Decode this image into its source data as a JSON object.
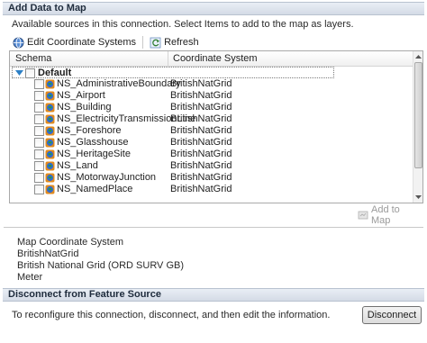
{
  "add_section": {
    "title": "Add Data to Map",
    "description": "Available sources in this connection.  Select Items to add to the map as layers."
  },
  "toolbar": {
    "edit_label": "Edit Coordinate Systems",
    "refresh_label": "Refresh"
  },
  "grid": {
    "columns": [
      "Schema",
      "Coordinate System"
    ],
    "group": "Default",
    "rows": [
      {
        "name": "NS_AdministrativeBoundary",
        "cs": "BritishNatGrid"
      },
      {
        "name": "NS_Airport",
        "cs": "BritishNatGrid"
      },
      {
        "name": "NS_Building",
        "cs": "BritishNatGrid"
      },
      {
        "name": "NS_ElectricityTransmissionLine",
        "cs": "BritishNatGrid"
      },
      {
        "name": "NS_Foreshore",
        "cs": "BritishNatGrid"
      },
      {
        "name": "NS_Glasshouse",
        "cs": "BritishNatGrid"
      },
      {
        "name": "NS_HeritageSite",
        "cs": "BritishNatGrid"
      },
      {
        "name": "NS_Land",
        "cs": "BritishNatGrid"
      },
      {
        "name": "NS_MotorwayJunction",
        "cs": "BritishNatGrid"
      },
      {
        "name": "NS_NamedPlace",
        "cs": "BritishNatGrid"
      }
    ]
  },
  "add_to_map_label": "Add to Map",
  "map_cs": {
    "title": "Map Coordinate System",
    "code": "BritishNatGrid",
    "description": "British National Grid (ORD SURV GB)",
    "units": "Meter"
  },
  "disconnect_section": {
    "title": "Disconnect from Feature Source",
    "description": "To reconfigure this connection, disconnect, and then edit the information.",
    "button_label": "Disconnect"
  },
  "colors": {
    "header_bg": "#d9e0ea",
    "icon_blue": "#2f6bd1",
    "icon_green": "#2e9a3a",
    "icon_orange": "#e08a1e"
  },
  "icons": [
    "globe-icon",
    "refresh-icon",
    "expand-triangle-icon",
    "feature-source-icon",
    "add-to-map-icon"
  ]
}
